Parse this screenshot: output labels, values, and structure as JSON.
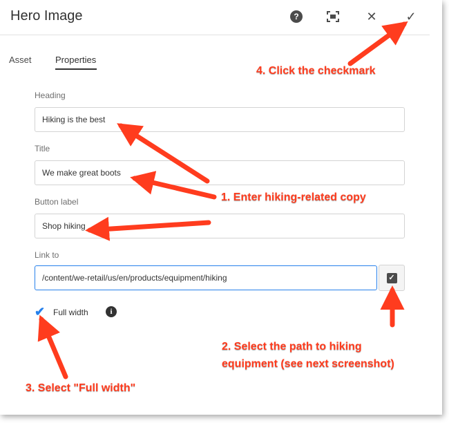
{
  "dialog": {
    "title": "Hero Image",
    "header_icons": [
      "help-icon",
      "fullscreen-icon",
      "close-icon",
      "checkmark-icon"
    ]
  },
  "tabs": [
    {
      "label": "Asset"
    },
    {
      "label": "Properties"
    }
  ],
  "form": {
    "heading": {
      "label": "Heading",
      "value": "Hiking is the best"
    },
    "title": {
      "label": "Title",
      "value": "We make great boots"
    },
    "button_label": {
      "label": "Button label",
      "value": "Shop hiking"
    },
    "link_to": {
      "label": "Link to",
      "value": "/content/we-retail/us/en/products/equipment/hiking"
    },
    "full_width": {
      "label": "Full width",
      "checked": true
    }
  },
  "annotations": {
    "step4": "4. Click the checkmark",
    "step1": "1. Enter hiking-related copy",
    "step2_line1": "2. Select the path to hiking",
    "step2_line2": "equipment (see next screenshot)",
    "step3": "3. Select \"Full width\""
  },
  "colors": {
    "accent": "#2680eb",
    "annotation": "#ff3c1e"
  }
}
